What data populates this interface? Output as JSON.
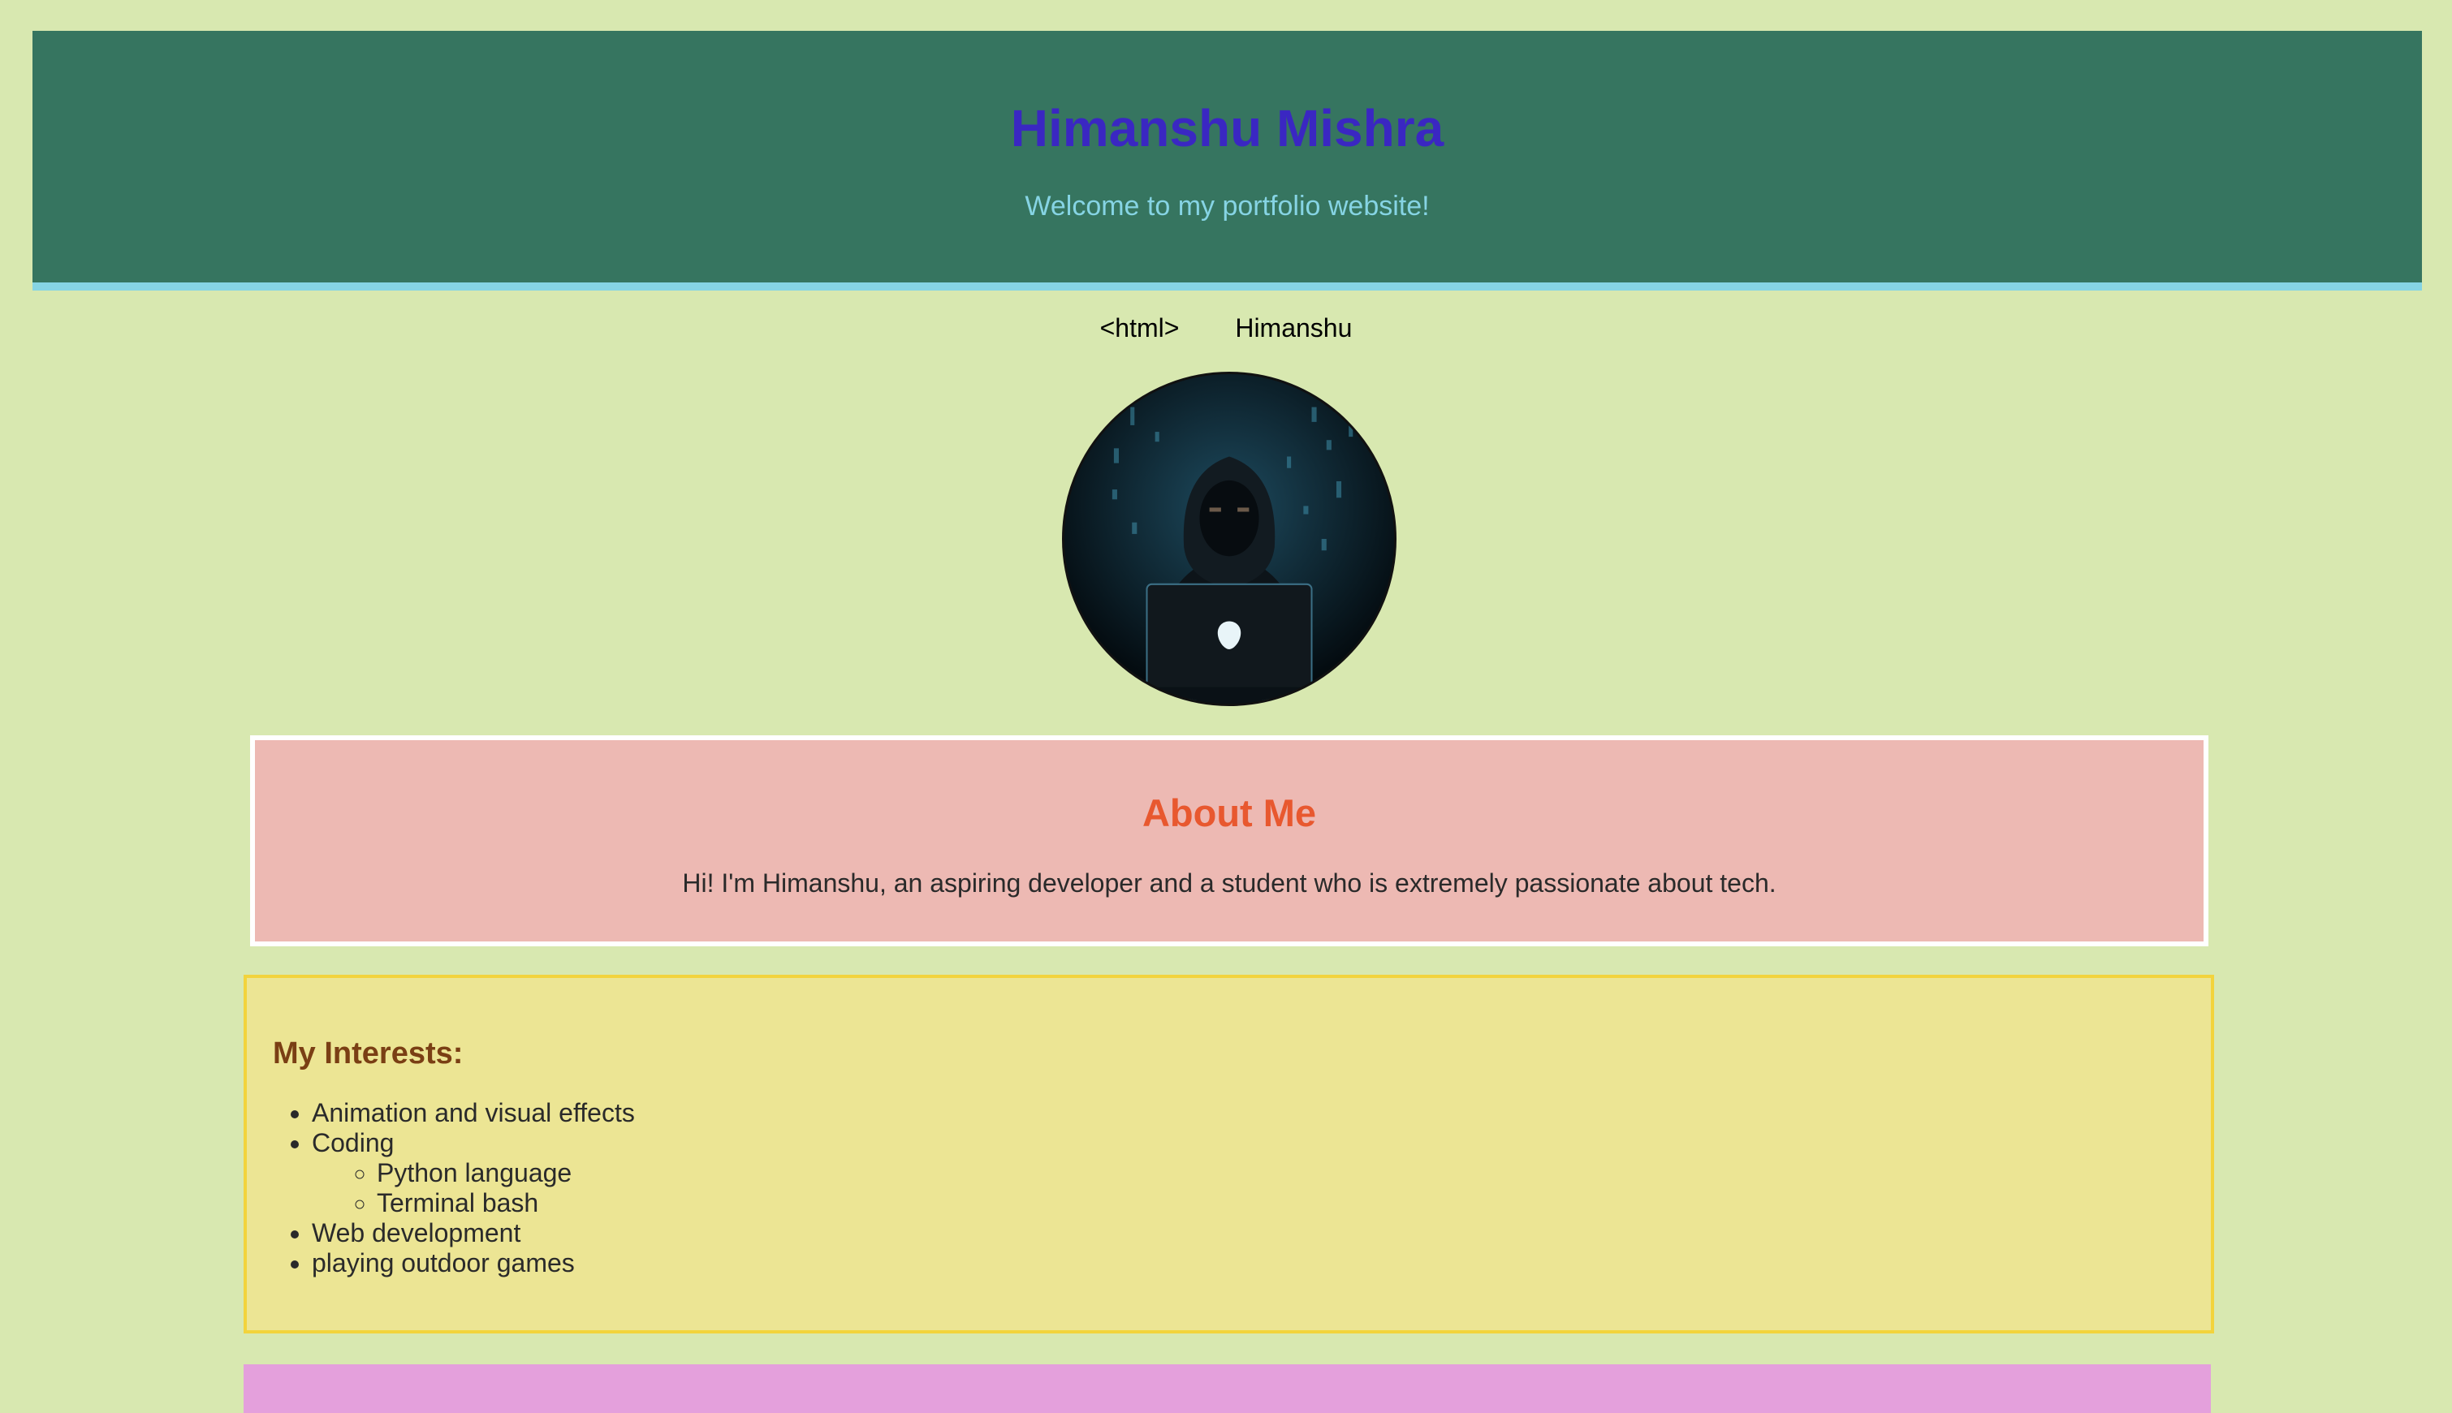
{
  "header": {
    "title": "Himanshu Mishra",
    "subtitle": "Welcome to my portfolio website!"
  },
  "nav": {
    "items": [
      {
        "label": "<html>"
      },
      {
        "label": "Himanshu"
      }
    ]
  },
  "profile": {
    "image": "hooded-figure-with-laptop-avatar"
  },
  "about": {
    "heading": "About Me",
    "text": "Hi! I'm Himanshu, an aspiring developer and a student who is extremely passionate about tech."
  },
  "interests": {
    "heading": "My Interests:",
    "items": [
      {
        "label": "Animation and visual effects"
      },
      {
        "label": "Coding",
        "sub": [
          {
            "label": "Python language"
          },
          {
            "label": "Terminal bash"
          }
        ]
      },
      {
        "label": "Web development"
      },
      {
        "label": "playing outdoor games"
      }
    ]
  },
  "colors": {
    "page_bg": "#d8e8b0",
    "header_bg": "#367560",
    "header_border": "#86d4e4",
    "title": "#3a27c2",
    "about_bg": "#edb9b3",
    "about_heading": "#e8582f",
    "interests_bg": "#ece594",
    "interests_border": "#f2d33c",
    "interests_heading": "#7a3f14",
    "next_section_bg": "#e4a0dc"
  }
}
